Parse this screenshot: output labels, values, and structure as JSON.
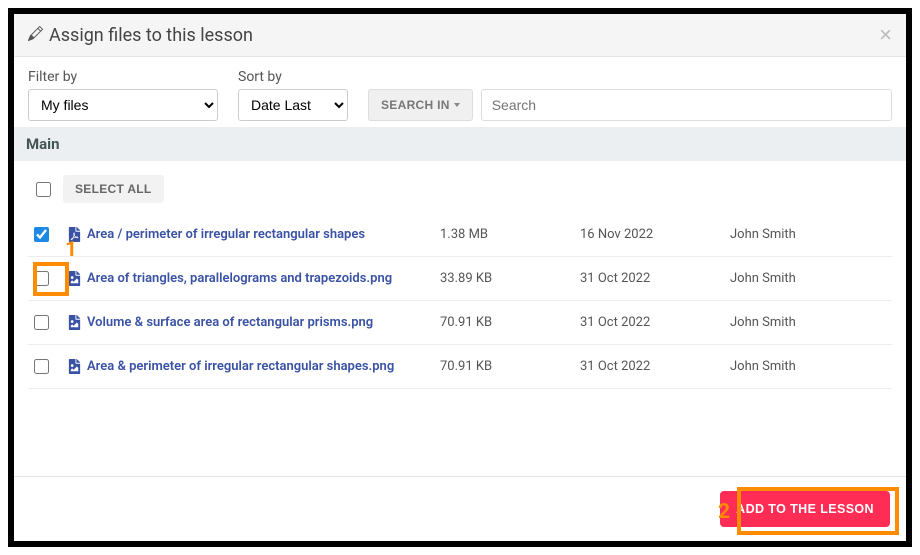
{
  "modal": {
    "title": "Assign files to this lesson"
  },
  "filters": {
    "filter_label": "Filter by",
    "filter_value": "My files",
    "sort_label": "Sort by",
    "sort_value": "Date Last",
    "search_in_label": "SEARCH IN",
    "search_placeholder": "Search",
    "search_value": ""
  },
  "section": {
    "title": "Main"
  },
  "select_all_label": "SELECT ALL",
  "files": [
    {
      "checked": true,
      "icon": "pdf",
      "name": "Area / perimeter of irregular rectangular shapes",
      "size": "1.38 MB",
      "date": "16 Nov 2022",
      "owner": "John Smith"
    },
    {
      "checked": false,
      "icon": "image",
      "name": "Area of triangles, parallelograms and trapezoids.png",
      "size": "33.89 KB",
      "date": "31 Oct 2022",
      "owner": "John Smith"
    },
    {
      "checked": false,
      "icon": "image",
      "name": "Volume & surface area of rectangular prisms.png",
      "size": "70.91 KB",
      "date": "31 Oct 2022",
      "owner": "John Smith"
    },
    {
      "checked": false,
      "icon": "image",
      "name": "Area & perimeter of irregular rectangular shapes.png",
      "size": "70.91 KB",
      "date": "31 Oct 2022",
      "owner": "John Smith"
    }
  ],
  "footer": {
    "add_label": "ADD TO THE LESSON"
  },
  "annotations": {
    "one": "1",
    "two": "2"
  }
}
